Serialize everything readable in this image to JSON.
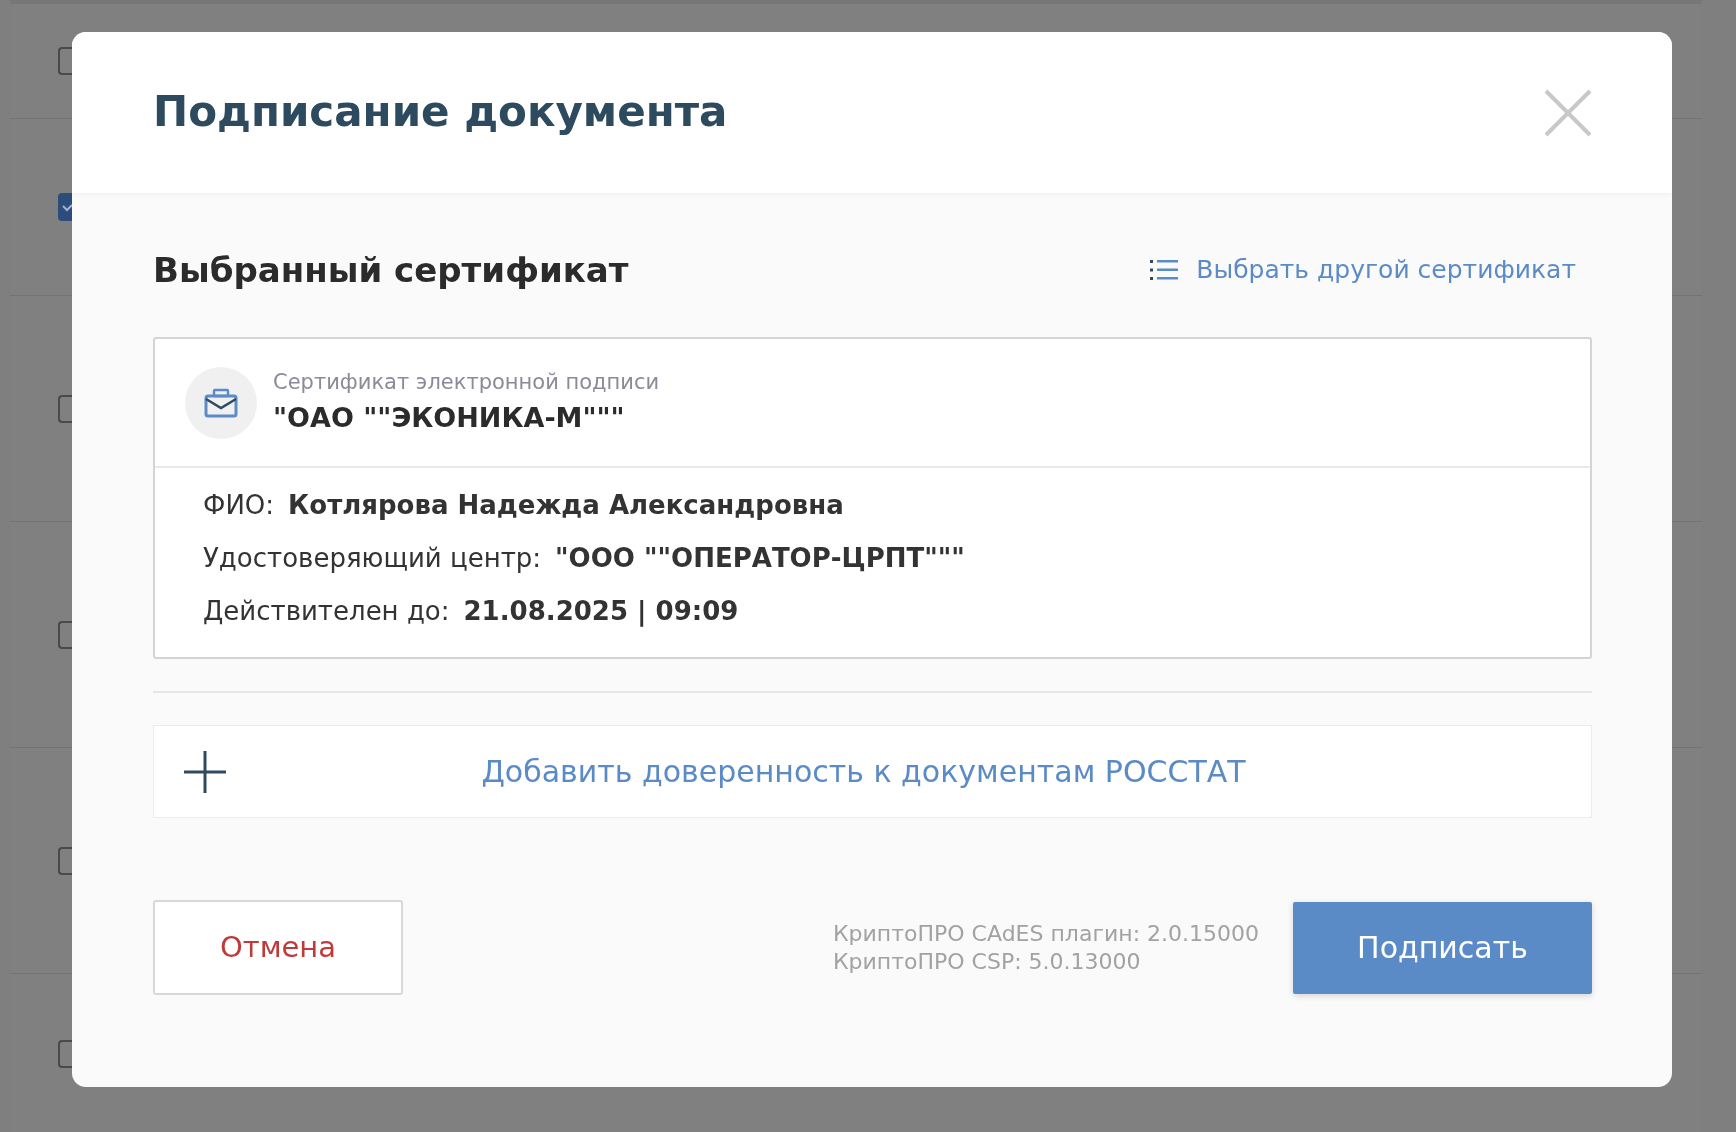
{
  "background_rows": [
    {
      "checked": false
    },
    {
      "checked": true
    },
    {
      "checked": false
    },
    {
      "checked": false
    },
    {
      "checked": false
    },
    {
      "checked": false
    }
  ],
  "modal": {
    "title": "Подписание документа",
    "section_title": "Выбранный сертификат",
    "change_link": "Выбрать другой сертификат",
    "certificate": {
      "type_label": "Сертификат электронной подписи",
      "name": "\"ОАО \"\"ЭКОНИКА-М\"\"\"",
      "fields": [
        {
          "label": "ФИО:",
          "value": "Котлярова Надежда Александровна"
        },
        {
          "label": "Удостоверяющий центр:",
          "value": "\"ООО \"\"ОПЕРАТОР-ЦРПТ\"\"\""
        },
        {
          "label": "Действителен до:",
          "value": "21.08.2025 | 09:09"
        }
      ]
    },
    "add_power_of_attorney": "Добавить доверенность к документам РОССТАТ",
    "cancel_button": "Отмена",
    "versions": [
      "КриптоПРО CAdES плагин: 2.0.15000",
      "КриптоПРО CSP: 5.0.13000"
    ],
    "sign_button": "Подписать"
  }
}
